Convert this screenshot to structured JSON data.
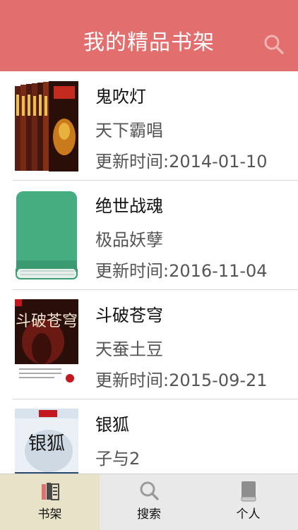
{
  "header": {
    "title": "我的精品书架"
  },
  "books": [
    {
      "title": "鬼吹灯",
      "author": "天下霸唱",
      "updated": "更新时间:2014-01-10",
      "cover": "book-set-cover"
    },
    {
      "title": "绝世战魂",
      "author": "极品妖孽",
      "updated": "更新时间:2016-11-04",
      "cover": "green-book-cover"
    },
    {
      "title": "斗破苍穹",
      "author": "天蚕土豆",
      "updated": "更新时间:2015-09-21",
      "cover": "doupo-cover",
      "cover_text": "斗破苍穹"
    },
    {
      "title": "银狐",
      "author": "子与2",
      "updated": "",
      "cover": "yinhu-cover",
      "cover_text": "银狐"
    }
  ],
  "tabbar": {
    "tabs": [
      {
        "label": "书架",
        "icon": "bookshelf-icon",
        "active": true
      },
      {
        "label": "搜索",
        "icon": "search-icon",
        "active": false
      },
      {
        "label": "个人",
        "icon": "book-icon",
        "active": false
      }
    ]
  },
  "colors": {
    "header_bg": "#e36e6e",
    "active_tab_bg": "#e8e2c8",
    "tabbar_bg": "#e9e9e9"
  }
}
